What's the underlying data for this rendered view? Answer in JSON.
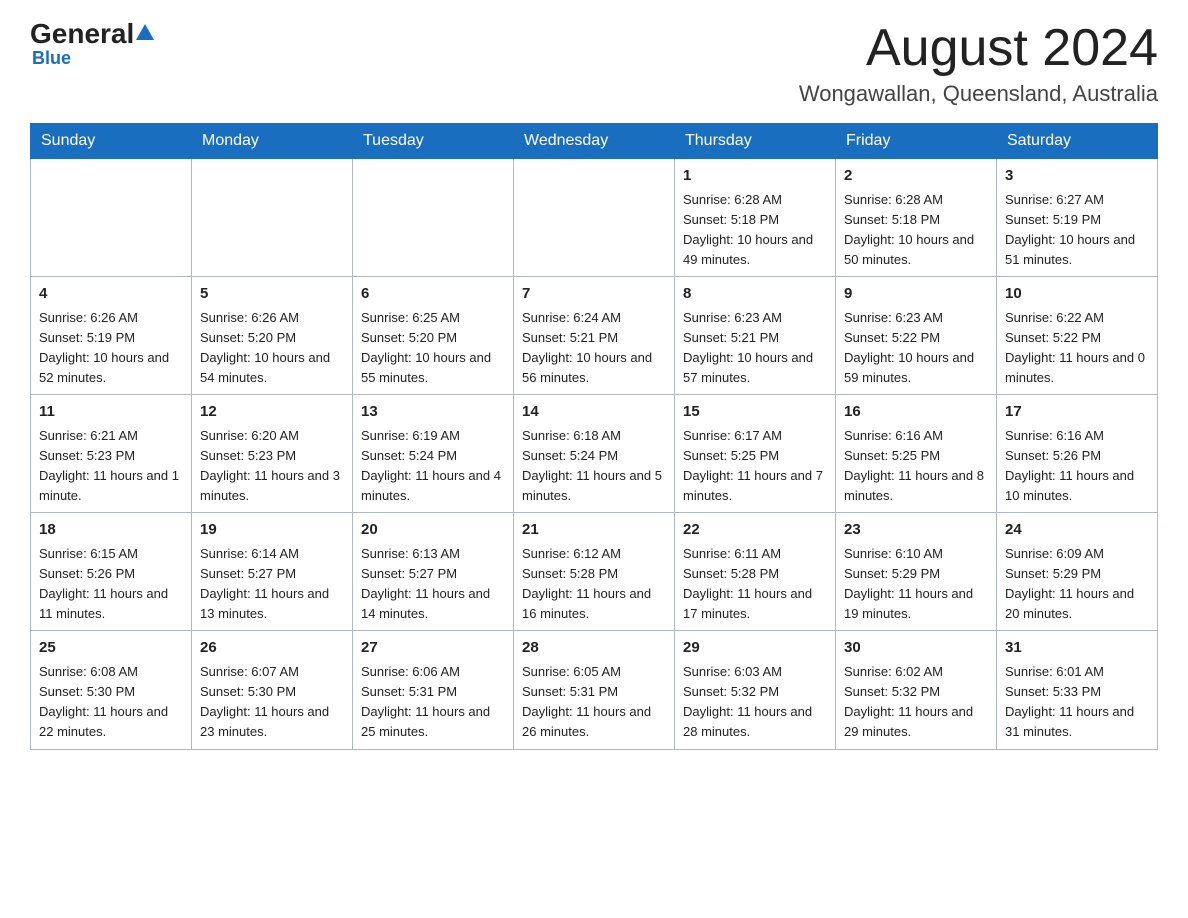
{
  "logo": {
    "general": "General",
    "blue": "Blue",
    "subtitle": "Blue"
  },
  "header": {
    "month": "August 2024",
    "location": "Wongawallan, Queensland, Australia"
  },
  "weekdays": [
    "Sunday",
    "Monday",
    "Tuesday",
    "Wednesday",
    "Thursday",
    "Friday",
    "Saturday"
  ],
  "weeks": [
    [
      {
        "day": "",
        "info": ""
      },
      {
        "day": "",
        "info": ""
      },
      {
        "day": "",
        "info": ""
      },
      {
        "day": "",
        "info": ""
      },
      {
        "day": "1",
        "info": "Sunrise: 6:28 AM\nSunset: 5:18 PM\nDaylight: 10 hours and 49 minutes."
      },
      {
        "day": "2",
        "info": "Sunrise: 6:28 AM\nSunset: 5:18 PM\nDaylight: 10 hours and 50 minutes."
      },
      {
        "day": "3",
        "info": "Sunrise: 6:27 AM\nSunset: 5:19 PM\nDaylight: 10 hours and 51 minutes."
      }
    ],
    [
      {
        "day": "4",
        "info": "Sunrise: 6:26 AM\nSunset: 5:19 PM\nDaylight: 10 hours and 52 minutes."
      },
      {
        "day": "5",
        "info": "Sunrise: 6:26 AM\nSunset: 5:20 PM\nDaylight: 10 hours and 54 minutes."
      },
      {
        "day": "6",
        "info": "Sunrise: 6:25 AM\nSunset: 5:20 PM\nDaylight: 10 hours and 55 minutes."
      },
      {
        "day": "7",
        "info": "Sunrise: 6:24 AM\nSunset: 5:21 PM\nDaylight: 10 hours and 56 minutes."
      },
      {
        "day": "8",
        "info": "Sunrise: 6:23 AM\nSunset: 5:21 PM\nDaylight: 10 hours and 57 minutes."
      },
      {
        "day": "9",
        "info": "Sunrise: 6:23 AM\nSunset: 5:22 PM\nDaylight: 10 hours and 59 minutes."
      },
      {
        "day": "10",
        "info": "Sunrise: 6:22 AM\nSunset: 5:22 PM\nDaylight: 11 hours and 0 minutes."
      }
    ],
    [
      {
        "day": "11",
        "info": "Sunrise: 6:21 AM\nSunset: 5:23 PM\nDaylight: 11 hours and 1 minute."
      },
      {
        "day": "12",
        "info": "Sunrise: 6:20 AM\nSunset: 5:23 PM\nDaylight: 11 hours and 3 minutes."
      },
      {
        "day": "13",
        "info": "Sunrise: 6:19 AM\nSunset: 5:24 PM\nDaylight: 11 hours and 4 minutes."
      },
      {
        "day": "14",
        "info": "Sunrise: 6:18 AM\nSunset: 5:24 PM\nDaylight: 11 hours and 5 minutes."
      },
      {
        "day": "15",
        "info": "Sunrise: 6:17 AM\nSunset: 5:25 PM\nDaylight: 11 hours and 7 minutes."
      },
      {
        "day": "16",
        "info": "Sunrise: 6:16 AM\nSunset: 5:25 PM\nDaylight: 11 hours and 8 minutes."
      },
      {
        "day": "17",
        "info": "Sunrise: 6:16 AM\nSunset: 5:26 PM\nDaylight: 11 hours and 10 minutes."
      }
    ],
    [
      {
        "day": "18",
        "info": "Sunrise: 6:15 AM\nSunset: 5:26 PM\nDaylight: 11 hours and 11 minutes."
      },
      {
        "day": "19",
        "info": "Sunrise: 6:14 AM\nSunset: 5:27 PM\nDaylight: 11 hours and 13 minutes."
      },
      {
        "day": "20",
        "info": "Sunrise: 6:13 AM\nSunset: 5:27 PM\nDaylight: 11 hours and 14 minutes."
      },
      {
        "day": "21",
        "info": "Sunrise: 6:12 AM\nSunset: 5:28 PM\nDaylight: 11 hours and 16 minutes."
      },
      {
        "day": "22",
        "info": "Sunrise: 6:11 AM\nSunset: 5:28 PM\nDaylight: 11 hours and 17 minutes."
      },
      {
        "day": "23",
        "info": "Sunrise: 6:10 AM\nSunset: 5:29 PM\nDaylight: 11 hours and 19 minutes."
      },
      {
        "day": "24",
        "info": "Sunrise: 6:09 AM\nSunset: 5:29 PM\nDaylight: 11 hours and 20 minutes."
      }
    ],
    [
      {
        "day": "25",
        "info": "Sunrise: 6:08 AM\nSunset: 5:30 PM\nDaylight: 11 hours and 22 minutes."
      },
      {
        "day": "26",
        "info": "Sunrise: 6:07 AM\nSunset: 5:30 PM\nDaylight: 11 hours and 23 minutes."
      },
      {
        "day": "27",
        "info": "Sunrise: 6:06 AM\nSunset: 5:31 PM\nDaylight: 11 hours and 25 minutes."
      },
      {
        "day": "28",
        "info": "Sunrise: 6:05 AM\nSunset: 5:31 PM\nDaylight: 11 hours and 26 minutes."
      },
      {
        "day": "29",
        "info": "Sunrise: 6:03 AM\nSunset: 5:32 PM\nDaylight: 11 hours and 28 minutes."
      },
      {
        "day": "30",
        "info": "Sunrise: 6:02 AM\nSunset: 5:32 PM\nDaylight: 11 hours and 29 minutes."
      },
      {
        "day": "31",
        "info": "Sunrise: 6:01 AM\nSunset: 5:33 PM\nDaylight: 11 hours and 31 minutes."
      }
    ]
  ]
}
